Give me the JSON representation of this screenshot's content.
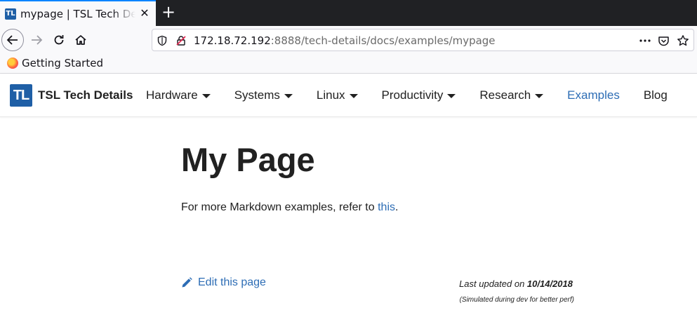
{
  "browser": {
    "tab": {
      "title": "mypage | TSL Tech Details",
      "favicon_text": "TL"
    },
    "new_tab_label": "+",
    "url": {
      "host": "172.18.72.192",
      "rest": ":8888/tech-details/docs/examples/mypage"
    },
    "bookmarks": [
      {
        "label": "Getting Started",
        "icon": "firefox-icon"
      }
    ]
  },
  "site": {
    "logo_text": "TL",
    "brand": "TSL Tech Details",
    "menu": [
      {
        "label": "Hardware",
        "dropdown": true
      },
      {
        "label": "Systems",
        "dropdown": true
      },
      {
        "label": "Linux",
        "dropdown": true
      },
      {
        "label": "Productivity",
        "dropdown": true
      },
      {
        "label": "Research",
        "dropdown": true
      },
      {
        "label": "Examples",
        "dropdown": false,
        "active": true
      },
      {
        "label": "Blog",
        "dropdown": false
      }
    ]
  },
  "content": {
    "title": "My Page",
    "intro_prefix": "For more Markdown examples, refer to ",
    "intro_link": "this",
    "intro_suffix": "."
  },
  "footer": {
    "edit_label": "Edit this page",
    "updated_prefix": "Last updated on ",
    "updated_date": "10/14/2018",
    "simulated_note": "(Simulated during dev for better perf)"
  },
  "colors": {
    "accent": "#2d6db5",
    "logo": "#1f5fa6",
    "tabstrip": "#202124"
  }
}
